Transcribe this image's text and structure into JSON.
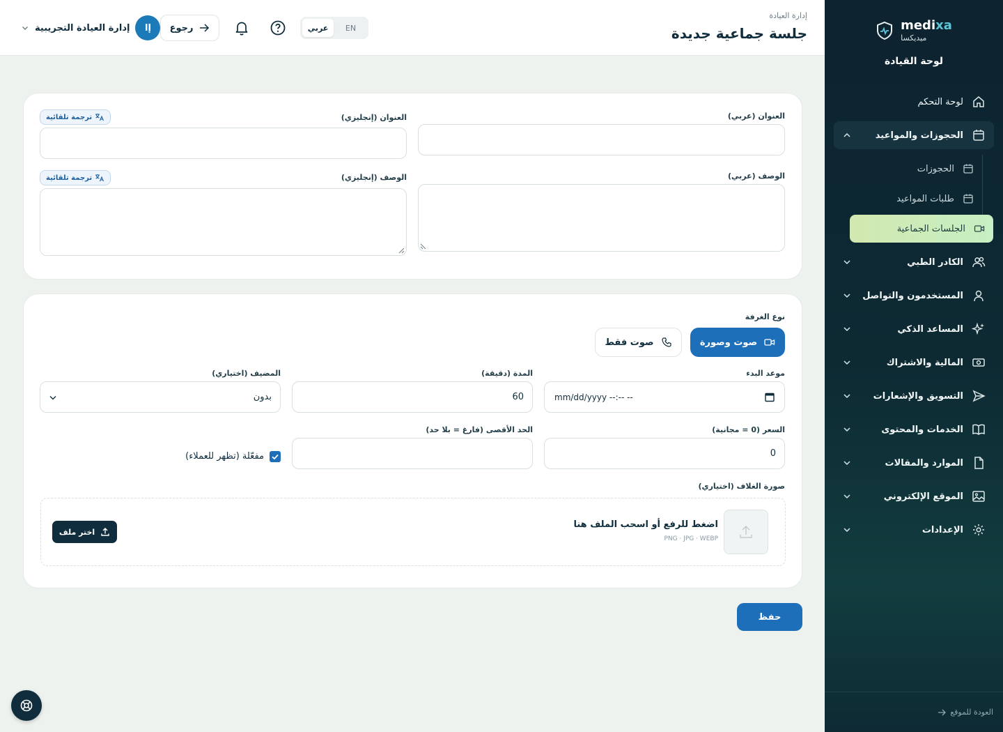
{
  "sidebar": {
    "brand_en_a": "medi",
    "brand_en_b": "xa",
    "brand_ar": "ميديكسا",
    "title": "لوحة القيادة",
    "items": [
      {
        "label": "لوحة التحكم",
        "icon": "home-icon"
      },
      {
        "label": "الحجوزات والمواعيد",
        "icon": "calendar-icon",
        "expanded": true
      },
      {
        "label": "الكادر الطبي",
        "icon": "users-icon"
      },
      {
        "label": "المستخدمون والتواصل",
        "icon": "user-icon"
      },
      {
        "label": "المساعد الذكي",
        "icon": "sparkles-icon"
      },
      {
        "label": "المالية والاشتراك",
        "icon": "money-icon"
      },
      {
        "label": "التسويق والإشعارات",
        "icon": "send-icon"
      },
      {
        "label": "الخدمات والمحتوى",
        "icon": "book-icon"
      },
      {
        "label": "الموارد والمقالات",
        "icon": "file-icon"
      },
      {
        "label": "الموقع الإلكتروني",
        "icon": "image-icon"
      },
      {
        "label": "الإعدادات",
        "icon": "gear-icon"
      }
    ],
    "subitems": [
      {
        "label": "الحجوزات",
        "icon": "calendar-icon"
      },
      {
        "label": "طلبات المواعيد",
        "icon": "calendar-icon"
      },
      {
        "label": "الجلسات الجماعية",
        "icon": "video-icon",
        "active": true
      }
    ],
    "footer": "العودة للموقع"
  },
  "header": {
    "breadcrumb": "إدارة العيادة",
    "title": "جلسة جماعية جديدة",
    "lang_ar": "عربي",
    "lang_en": "EN",
    "back_label": "رجوع",
    "user_initials": "إا",
    "user_name": "إدارة العيادة التجريبية"
  },
  "form": {
    "title_ar_label": "العنوان (عربي)",
    "title_en_label": "العنوان (إنجليزي)",
    "desc_ar_label": "الوصف (عربي)",
    "desc_en_label": "الوصف (إنجليزي)",
    "auto_translate": "ترجمة تلقائية",
    "room_type_label": "نوع الغرفة",
    "room_video": "صوت وصورة",
    "room_audio": "صوت فقط",
    "start_label": "موعد البدء",
    "start_placeholder": "mm/dd/yyyy --:-- --",
    "duration_label": "المدة (دقيقة)",
    "duration_value": "60",
    "host_label": "المضيف (اختياري)",
    "host_value": "بدون",
    "price_label": "السعر (0 = مجانية)",
    "price_value": "0",
    "max_label": "الحد الأقصى (فارغ = بلا حد)",
    "enabled_label": "مفعّلة (تظهر للعملاء)",
    "enabled": true,
    "cover_label": "صورة الغلاف (اختياري)",
    "upload_title": "اضغط للرفع أو اسحب الملف هنا",
    "upload_formats": "PNG · JPG · WEBP",
    "pick_file": "اختر ملف",
    "save": "حفظ"
  },
  "colors": {
    "primary": "#1e6fba",
    "navy": "#0f2d3d",
    "active_grad": "#d3e8b0"
  }
}
